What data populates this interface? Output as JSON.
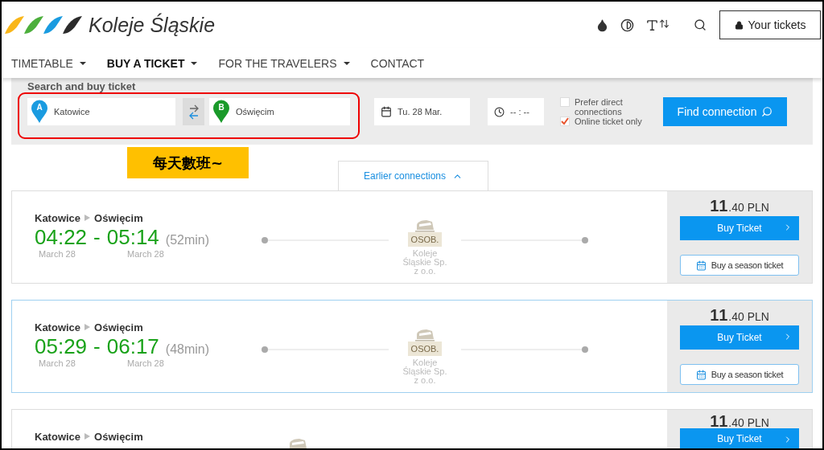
{
  "header": {
    "logo_text": "Koleje Śląskie",
    "tickets_button": "Your tickets"
  },
  "nav": [
    {
      "label": "TIMETABLE",
      "dropdown": true,
      "selected": false
    },
    {
      "label": "BUY A TICKET",
      "dropdown": true,
      "selected": true
    },
    {
      "label": "FOR THE TRAVELERS",
      "dropdown": true,
      "selected": false
    },
    {
      "label": "CONTACT",
      "dropdown": false,
      "selected": false
    }
  ],
  "search": {
    "title": "Search and buy ticket",
    "from": {
      "marker": "A",
      "value": "Katowice"
    },
    "to": {
      "marker": "B",
      "value": "Oświęcim"
    },
    "date": "Tu. 28 Mar.",
    "time": "-- : --",
    "options": [
      {
        "label": "Prefer direct connections",
        "checked": false
      },
      {
        "label": "Online ticket only",
        "checked": true
      }
    ],
    "button": "Find connection"
  },
  "annotation": {
    "label": "每天數班~"
  },
  "earlier_button": "Earlier connections",
  "connections": [
    {
      "from": "Katowice",
      "to": "Oświęcim",
      "departure": "04:22",
      "separator": "-",
      "arrival": "05:14",
      "duration": "(52min)",
      "departure_date": "March 28",
      "arrival_date": "March 28",
      "train_type": "OSOB.",
      "operator": "Koleje Śląskie Sp. z o.o.",
      "price_main": "11",
      "price_fraction": ".40 PLN",
      "buy_button": "Buy Ticket",
      "season_button": "Buy a season ticket",
      "highlighted": false
    },
    {
      "from": "Katowice",
      "to": "Oświęcim",
      "departure": "05:29",
      "separator": "-",
      "arrival": "06:17",
      "duration": "(48min)",
      "departure_date": "March 28",
      "arrival_date": "March 28",
      "train_type": "OSOB.",
      "operator": "Koleje Śląskie Sp. z o.o.",
      "price_main": "11",
      "price_fraction": ".40 PLN",
      "buy_button": "Buy Ticket",
      "season_button": "Buy a season ticket",
      "highlighted": true
    },
    {
      "from": "Katowice",
      "to": "Oświęcim",
      "price_main": "11",
      "price_fraction": ".40 PLN",
      "buy_button": "Buy Ticket",
      "highlighted": false
    }
  ]
}
